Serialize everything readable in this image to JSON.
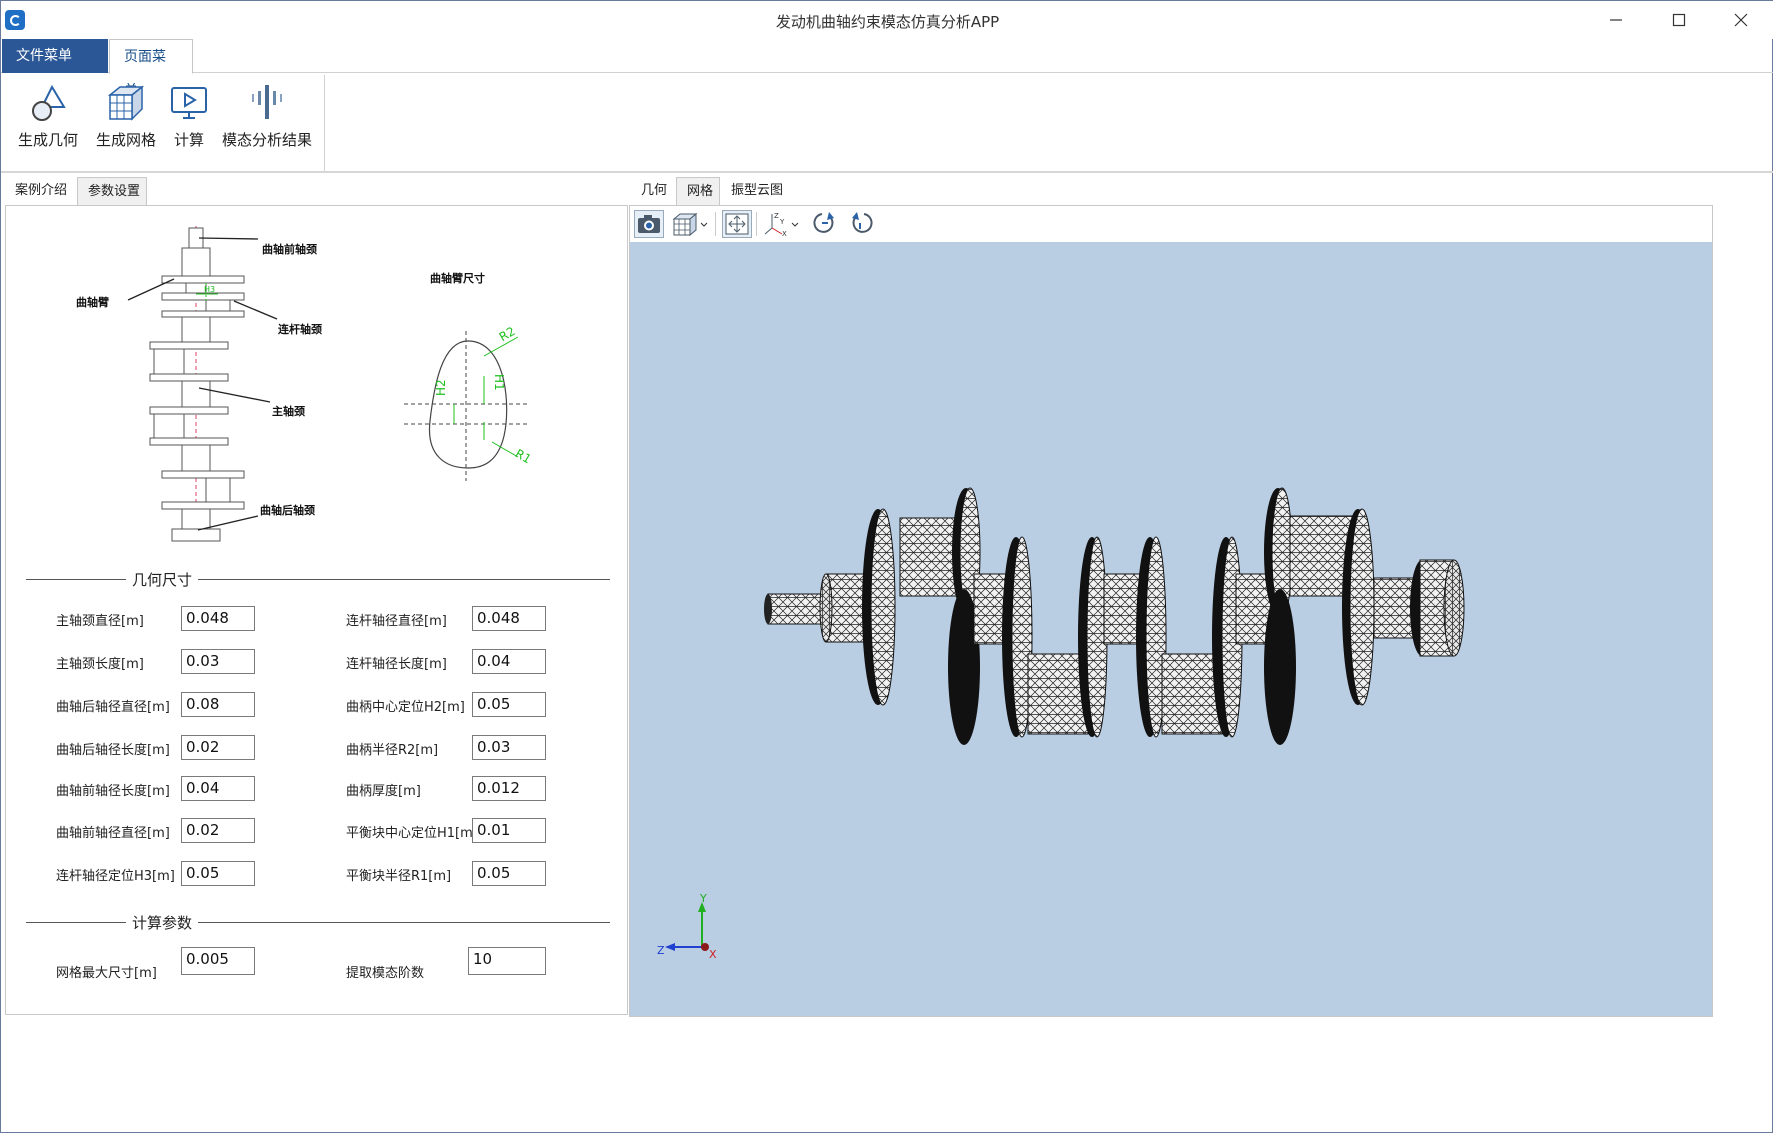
{
  "window": {
    "title": "发动机曲轴约束模态仿真分析APP"
  },
  "ribbon": {
    "tabs": [
      {
        "label": "文件菜单"
      },
      {
        "label": "页面菜单"
      }
    ],
    "buttons": [
      {
        "label": "生成几何",
        "icon": "geometry-icon"
      },
      {
        "label": "生成网格",
        "icon": "mesh-icon"
      },
      {
        "label": "计算",
        "icon": "compute-icon"
      },
      {
        "label": "模态分析结果",
        "icon": "modal-result-icon"
      }
    ]
  },
  "left": {
    "tabs": [
      {
        "label": "案例介绍"
      },
      {
        "label": "参数设置"
      }
    ],
    "diagram": {
      "labels": {
        "front_journal": "曲轴前轴颈",
        "arm": "曲轴臂",
        "crankpin": "连杆轴颈",
        "main_journal": "主轴颈",
        "rear_journal": "曲轴后轴颈",
        "arm_dims": "曲轴臂尺寸",
        "h3": "H3",
        "h1": "H1",
        "h2": "H2",
        "r1": "R1",
        "r2": "R2"
      }
    },
    "geometry_section": "几何尺寸",
    "geometry_params": [
      {
        "label": "主轴颈直径[m]",
        "value": "0.048"
      },
      {
        "label": "连杆轴径直径[m]",
        "value": "0.048"
      },
      {
        "label": "主轴颈长度[m]",
        "value": "0.03"
      },
      {
        "label": "连杆轴径长度[m]",
        "value": "0.04"
      },
      {
        "label": "曲轴后轴径直径[m]",
        "value": "0.08"
      },
      {
        "label": "曲柄中心定位H2[m]",
        "value": "0.05"
      },
      {
        "label": "曲轴后轴径长度[m]",
        "value": "0.02"
      },
      {
        "label": "曲柄半径R2[m]",
        "value": "0.03"
      },
      {
        "label": "曲轴前轴径长度[m]",
        "value": "0.04"
      },
      {
        "label": "曲柄厚度[m]",
        "value": "0.012"
      },
      {
        "label": "曲轴前轴径直径[m]",
        "value": "0.02"
      },
      {
        "label": "平衡块中心定位H1[m]",
        "value": "0.01"
      },
      {
        "label": "连杆轴径定位H3[m]",
        "value": "0.05"
      },
      {
        "label": "平衡块半径R1[m]",
        "value": "0.05"
      }
    ],
    "calc_section": "计算参数",
    "calc_params": [
      {
        "label": "网格最大尺寸[m]",
        "value": "0.005"
      },
      {
        "label": "提取模态阶数",
        "value": "10"
      }
    ]
  },
  "right": {
    "tabs": [
      {
        "label": "几何"
      },
      {
        "label": "网格"
      },
      {
        "label": "振型云图"
      }
    ],
    "toolbar": [
      {
        "icon": "camera-icon"
      },
      {
        "icon": "view-cube-icon"
      },
      {
        "icon": "fit-view-icon"
      },
      {
        "icon": "axes-orientation-icon"
      },
      {
        "icon": "rotate-cw-icon"
      },
      {
        "icon": "rotate-ccw-icon"
      }
    ],
    "triad": {
      "x": "X",
      "y": "Y",
      "z": "Z"
    },
    "colors": {
      "viewport_bg": "#b9cde3",
      "axis_x": "#d02020",
      "axis_y": "#20b020",
      "axis_z": "#2040d0"
    }
  }
}
